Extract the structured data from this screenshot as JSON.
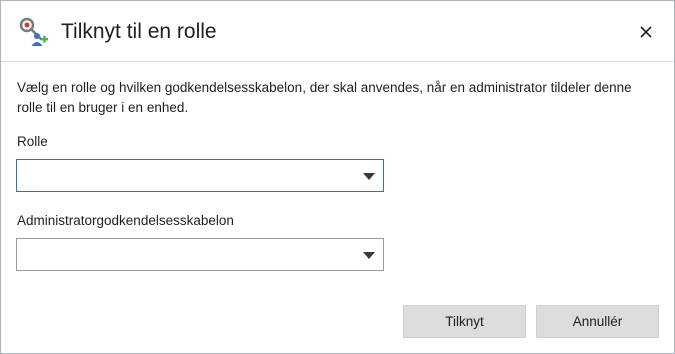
{
  "dialog": {
    "title": "Tilknyt til en rolle",
    "icon": "key-user-add-icon",
    "close_icon": "close-icon"
  },
  "description": "Vælg en rolle og hvilken godkendelsesskabelon, der skal anvendes, når en administrator tildeler denne rolle til en bruger i en enhed.",
  "fields": {
    "role": {
      "label": "Rolle",
      "value": ""
    },
    "template": {
      "label": "Administratorgodkendelsesskabelon",
      "value": ""
    }
  },
  "buttons": {
    "attach": "Tilknyt",
    "cancel": "Annullér"
  },
  "colors": {
    "focus_border": "#2f6fb0",
    "button_bg": "#dcdcdc",
    "icon_red": "#d23a3a",
    "icon_green": "#4caf50",
    "icon_blue": "#3b73b9"
  }
}
